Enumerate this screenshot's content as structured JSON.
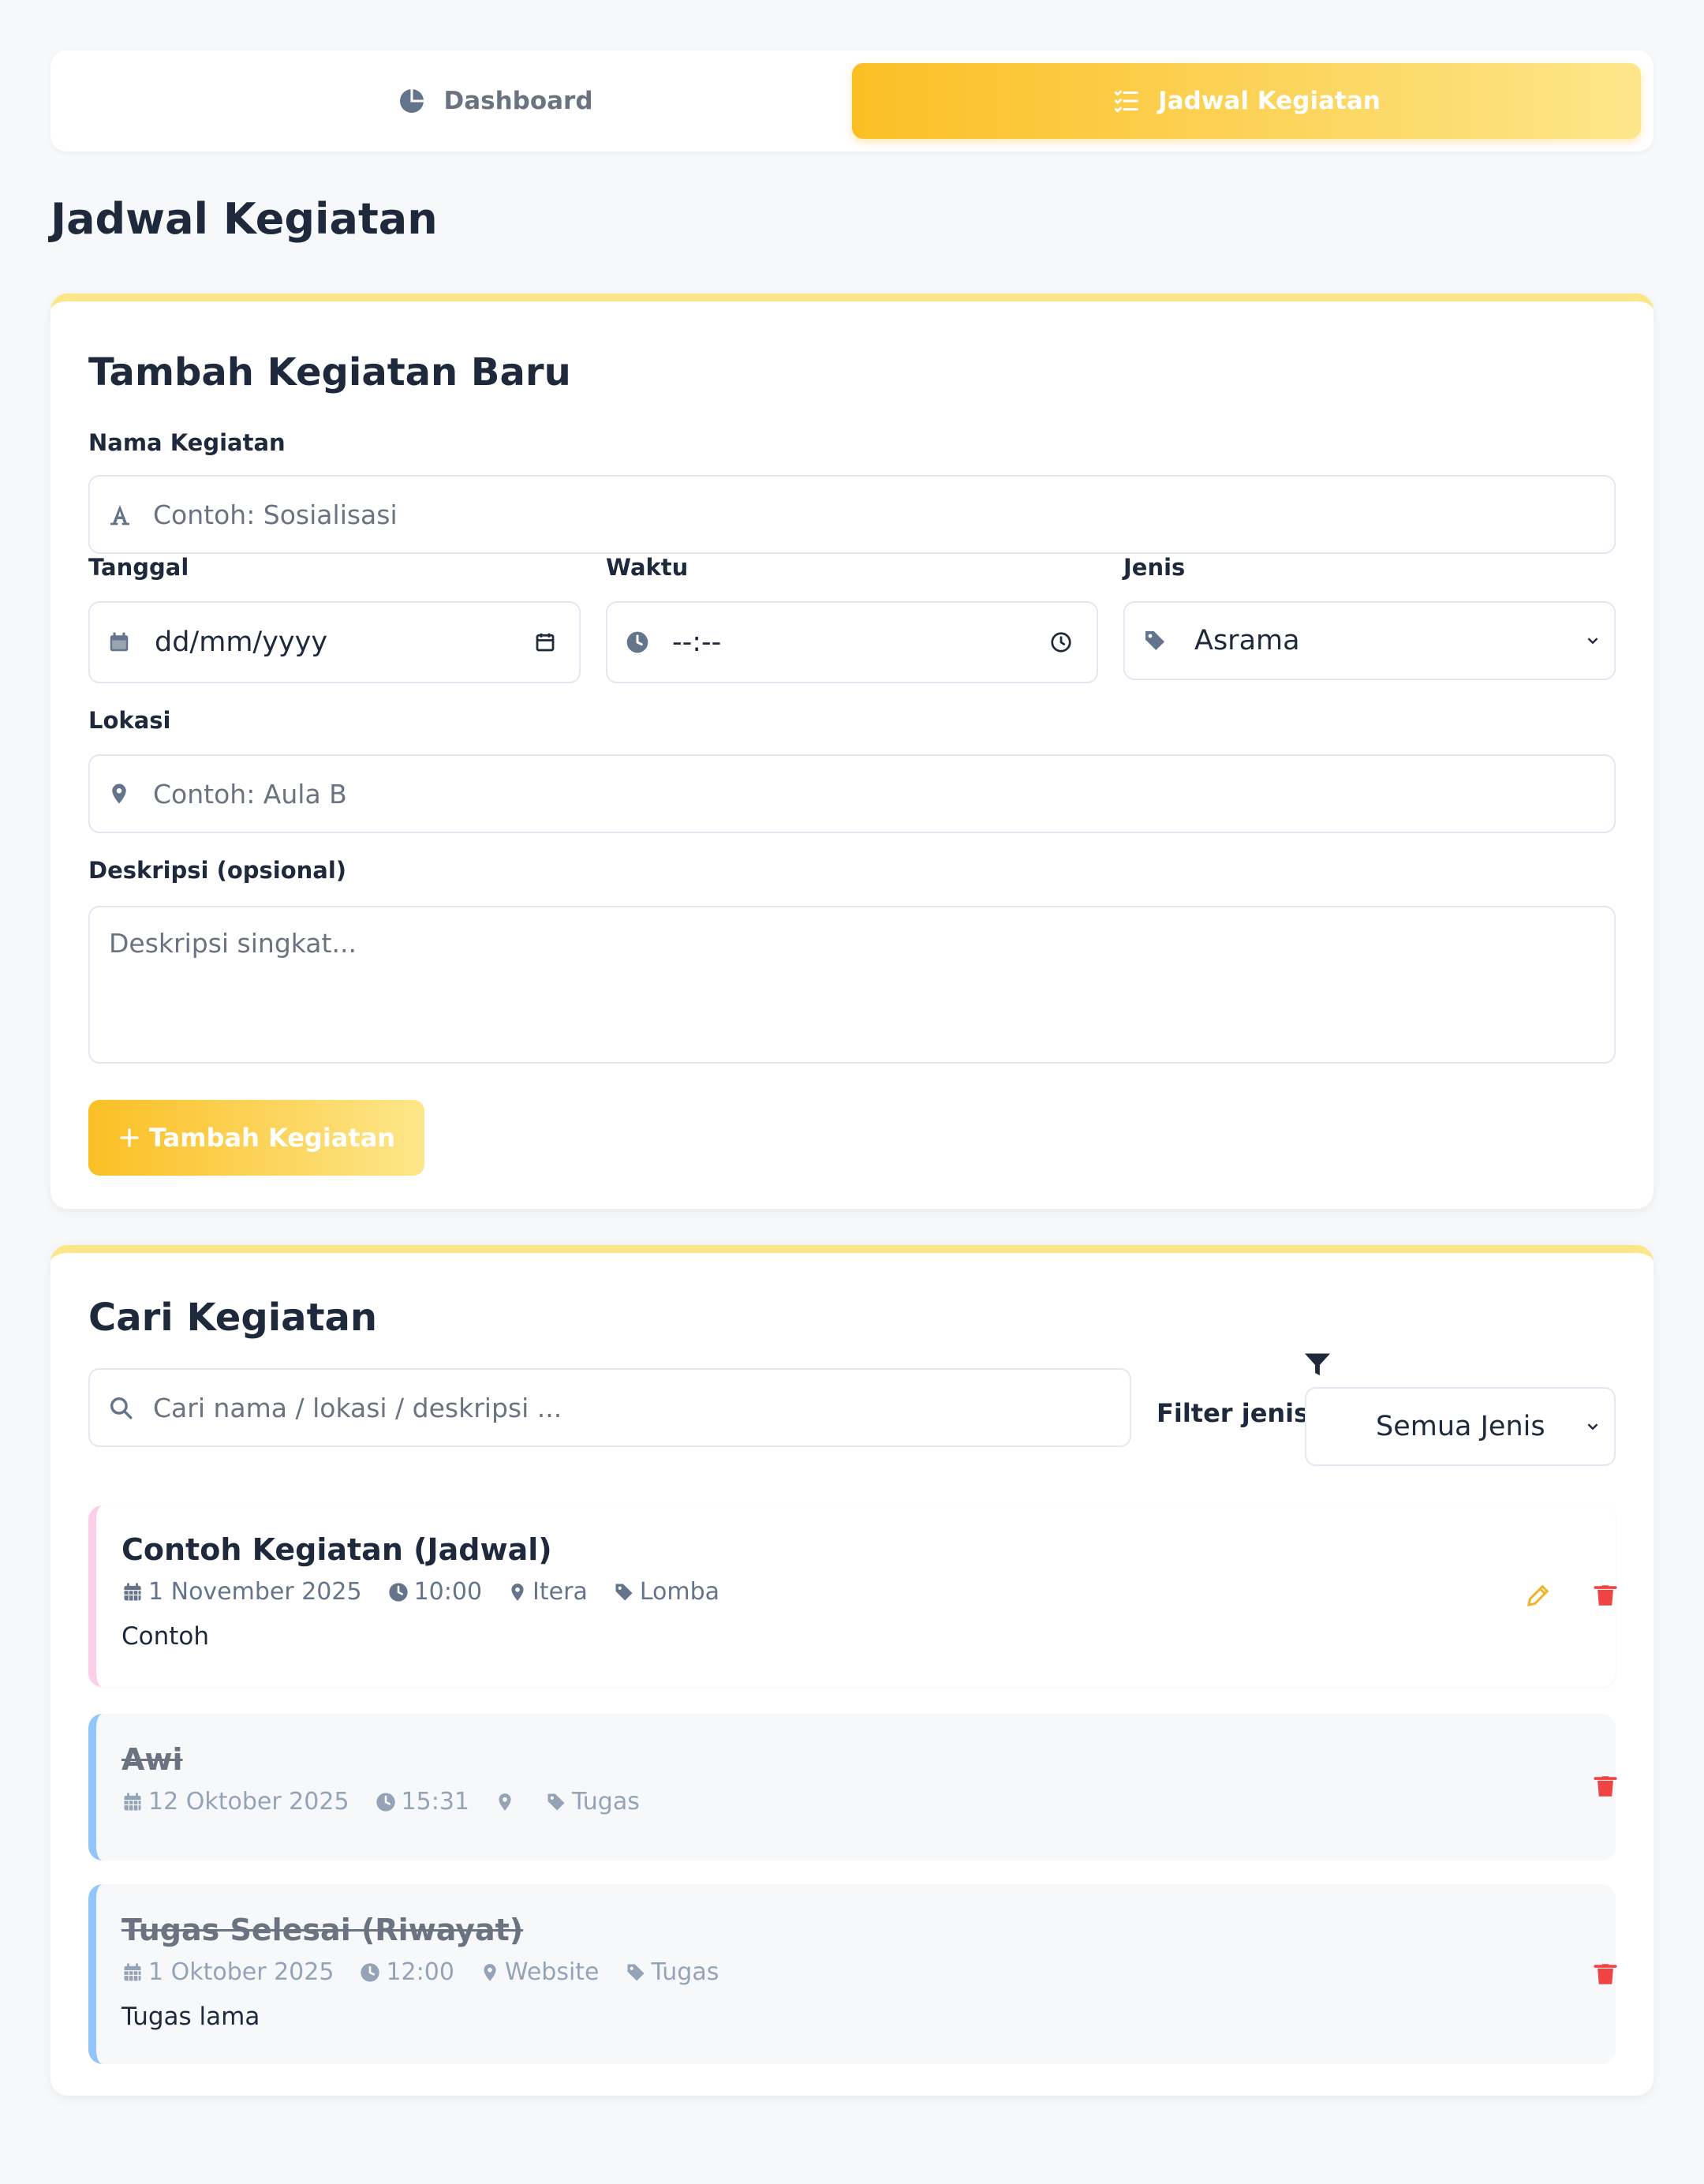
{
  "nav": {
    "tabs": [
      {
        "label": "Dashboard",
        "icon": "pie-chart-icon",
        "active": false
      },
      {
        "label": "Jadwal Kegiatan",
        "icon": "list-check-icon",
        "active": true
      }
    ]
  },
  "page_title": "Jadwal Kegiatan",
  "form": {
    "title": "Tambah Kegiatan Baru",
    "nama": {
      "label": "Nama Kegiatan",
      "placeholder": "Contoh: Sosialisasi"
    },
    "tanggal": {
      "label": "Tanggal",
      "value": "dd/mm/yyyy"
    },
    "waktu": {
      "label": "Waktu",
      "value": "--:--"
    },
    "jenis": {
      "label": "Jenis",
      "value": "Asrama"
    },
    "lokasi": {
      "label": "Lokasi",
      "placeholder": "Contoh: Aula B"
    },
    "deskripsi": {
      "label": "Deskripsi (opsional)",
      "placeholder": "Deskripsi singkat..."
    },
    "submit_label": "Tambah Kegiatan"
  },
  "search": {
    "title": "Cari Kegiatan",
    "placeholder": "Cari nama / lokasi / deskripsi ...",
    "filter_label": "Filter jenis:",
    "filter_value": "Semua Jenis"
  },
  "items": [
    {
      "title": "Contoh Kegiatan (Jadwal)",
      "date": "1 November 2025",
      "time": "10:00",
      "location": "Itera",
      "type": "Lomba",
      "description": "Contoh",
      "done": false
    },
    {
      "title": "Awi",
      "date": "12 Oktober 2025",
      "time": "15:31",
      "location": "",
      "type": "Tugas",
      "description": "",
      "done": true
    },
    {
      "title": "Tugas Selesai (Riwayat)",
      "date": "1 Oktober 2025",
      "time": "12:00",
      "location": "Website",
      "type": "Tugas",
      "description": "Tugas lama",
      "done": true
    }
  ],
  "colors": {
    "accent": "#fbbf24",
    "accent_light": "#fde68a",
    "edit": "#f0b429",
    "delete": "#ef4444",
    "border_lomba": "#fbcfe8",
    "border_tugas": "#93c5fd"
  }
}
